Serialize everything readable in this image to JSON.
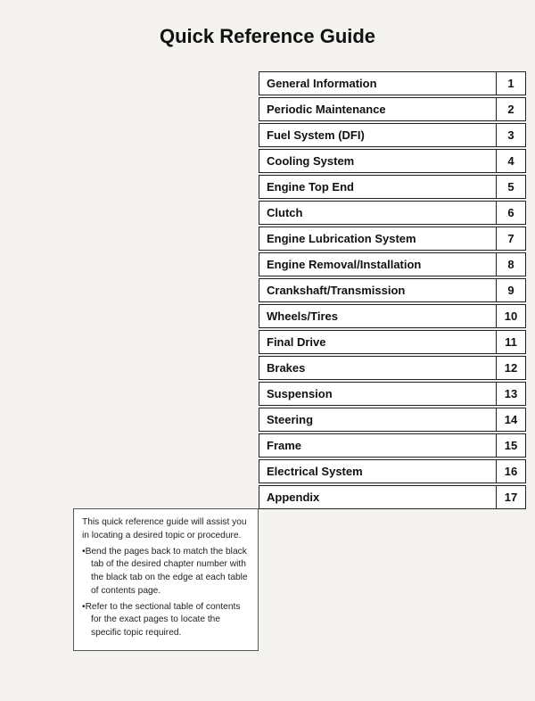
{
  "title": "Quick Reference Guide",
  "toc": {
    "items": [
      {
        "label": "General Information",
        "number": "1"
      },
      {
        "label": "Periodic Maintenance",
        "number": "2"
      },
      {
        "label": "Fuel System (DFI)",
        "number": "3"
      },
      {
        "label": "Cooling System",
        "number": "4"
      },
      {
        "label": "Engine Top End",
        "number": "5"
      },
      {
        "label": "Clutch",
        "number": "6"
      },
      {
        "label": "Engine Lubrication System",
        "number": "7"
      },
      {
        "label": "Engine Removal/Installation",
        "number": "8"
      },
      {
        "label": "Crankshaft/Transmission",
        "number": "9"
      },
      {
        "label": "Wheels/Tires",
        "number": "10"
      },
      {
        "label": "Final Drive",
        "number": "11"
      },
      {
        "label": "Brakes",
        "number": "12"
      },
      {
        "label": "Suspension",
        "number": "13"
      },
      {
        "label": "Steering",
        "number": "14"
      },
      {
        "label": "Frame",
        "number": "15"
      },
      {
        "label": "Electrical System",
        "number": "16"
      },
      {
        "label": "Appendix",
        "number": "17"
      }
    ]
  },
  "note": {
    "intro": "This quick reference guide will assist you in locating a desired topic or procedure.",
    "bullets": [
      "Bend the pages back to match the black tab of the desired chapter number with the black tab on the edge at each table of contents page.",
      "Refer to the sectional table of contents for the exact pages to locate the specific topic required."
    ]
  }
}
